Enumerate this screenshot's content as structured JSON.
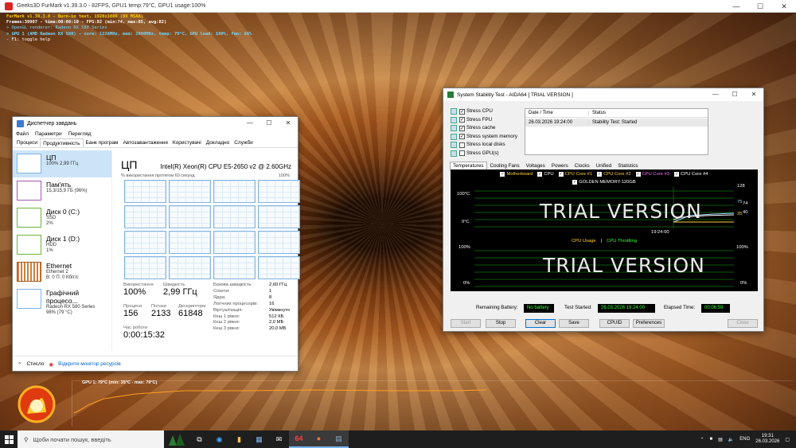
{
  "furmark": {
    "window_title": "Geeks3D FurMark v1.39.3.0 - 82FPS, GPU1 temp:79°C, GPU1 usage:100%",
    "overlay": [
      "FurMark v1.39.3.0 - Burn-in test, 1920x1080 (8X MSAA)",
      "Frames:39987 - time:00:08:10 - FPS:82 (min:74, max:85, avg:82)",
      "> OpenGL renderer: Radeon RX 580 Series",
      "> GPU 1 (AMD Radeon RX 580) - core: 1226MHz, mem: 2000MHz, temp: 79°C, GPU load: 100%, fan: 86%",
      "- F1: toggle help"
    ],
    "graph_label": "GPU 1: 79°C (min: 35°C - max: 79°C)"
  },
  "taskmgr": {
    "title": "Диспетчер завдань",
    "menu": [
      "Файл",
      "Параметри",
      "Перегляд"
    ],
    "tabs": [
      "Процеси",
      "Продуктивність",
      "Банк програм",
      "Автозавантаження",
      "Користувачі",
      "Докладно",
      "Служби"
    ],
    "side": [
      {
        "name": "ЦП",
        "sub1": "100% 2,99 ГГц",
        "sub2": ""
      },
      {
        "name": "Пам'ять",
        "sub1": "15,3/15,9 ГБ (96%)",
        "sub2": ""
      },
      {
        "name": "Диск 0 (C:)",
        "sub1": "SSD",
        "sub2": "2%"
      },
      {
        "name": "Диск 1 (D:)",
        "sub1": "HDD",
        "sub2": "1%"
      },
      {
        "name": "Ethernet",
        "sub1": "Ethernet 2",
        "sub2": "В: 0 П: 0 Кбіт/с"
      },
      {
        "name": "Графічний процесо...",
        "sub1": "Radeon RX 580 Series",
        "sub2": "98% (79 °C)"
      }
    ],
    "cpu_heading": "ЦП",
    "cpu_model": "Intel(R) Xeon(R) CPU E5-2650 v2 @ 2.60GHz",
    "axis_left": "% використання протягом 60 секунд",
    "axis_right": "100%",
    "stats": {
      "usage_label": "Використання",
      "usage": "100%",
      "speed_label": "Швидкість",
      "speed": "2,99 ГГц",
      "proc_label": "Процеси",
      "proc": "156",
      "threads_label": "Потоки",
      "threads": "2133",
      "handles_label": "Дескриптори",
      "handles": "61848",
      "uptime_label": "Час роботи",
      "uptime": "0:00:15:32"
    },
    "props": [
      {
        "k": "Базова швидкість:",
        "v": "2,60 ГГц"
      },
      {
        "k": "Сокети:",
        "v": "1"
      },
      {
        "k": "Ядра:",
        "v": "8"
      },
      {
        "k": "Логічних процесорів:",
        "v": "16"
      },
      {
        "k": "Віртуалізація:",
        "v": "Увімкнуто"
      },
      {
        "k": "Кеш 1 рівня:",
        "v": "512 КБ"
      },
      {
        "k": "Кеш 2 рівня:",
        "v": "2,0 МБ"
      },
      {
        "k": "Кеш 3 рівня:",
        "v": "20,0 МБ"
      }
    ],
    "footer_less": "Стисло",
    "footer_link": "Відкрити монітор ресурсів"
  },
  "aida": {
    "title": "System Stability Test - AIDA64  [ TRIAL VERSION ]",
    "stress": [
      {
        "label": "Stress CPU",
        "checked": true
      },
      {
        "label": "Stress FPU",
        "checked": true
      },
      {
        "label": "Stress cache",
        "checked": true
      },
      {
        "label": "Stress system memory",
        "checked": true
      },
      {
        "label": "Stress local disks",
        "checked": false
      },
      {
        "label": "Stress GPU(s)",
        "checked": false
      }
    ],
    "table_headers": [
      "Date / Time",
      "Status"
    ],
    "table_row": [
      "26.03.2026 19:24:00",
      "Stability Test: Started"
    ],
    "tabs": [
      "Temperatures",
      "Cooling Fans",
      "Voltages",
      "Powers",
      "Clocks",
      "Unified",
      "Statistics"
    ],
    "legend1": [
      {
        "label": "Motherboard",
        "color": "#ffd23a"
      },
      {
        "label": "CPU",
        "color": "#ffffff"
      },
      {
        "label": "CPU Core #1",
        "color": "#ffd23a"
      },
      {
        "label": "CPU Core #2",
        "color": "#ffd23a"
      },
      {
        "label": "CPU Core #3",
        "color": "#ff6aff"
      },
      {
        "label": "CPU Core #4",
        "color": "#ffffff"
      }
    ],
    "legend1b": "GOLDEN MEMORY-120GB",
    "watermark": "TRIAL VERSION",
    "chart1": {
      "ymax": "100°C",
      "ymin": "0°C",
      "time": "19:24:00",
      "r1": "75",
      "r1b": "74",
      "r2": "40",
      "r2b": "35",
      "top128": "128"
    },
    "legend2a": "CPU Usage",
    "legend2sep": "|",
    "legend2b": "CPU Throttling",
    "chart2": {
      "ymax": "100%",
      "ymin": "0%",
      "rmax": "100%",
      "rmin": "0%"
    },
    "battery_label": "Remaining Battery:",
    "battery": "No battery",
    "started_label": "Test Started:",
    "started": "26.03.2026 19:24:00",
    "elapsed_label": "Elapsed Time:",
    "elapsed": "00:06:59",
    "buttons": {
      "start": "Start",
      "stop": "Stop",
      "clear": "Clear",
      "save": "Save",
      "cpuid": "CPUID",
      "prefs": "Preferences",
      "close": "Close"
    }
  },
  "taskbar": {
    "search_placeholder": "Щоби почати пошук, введіть",
    "lang": "ENG",
    "time": "19:31",
    "date": "26.03.2026"
  }
}
